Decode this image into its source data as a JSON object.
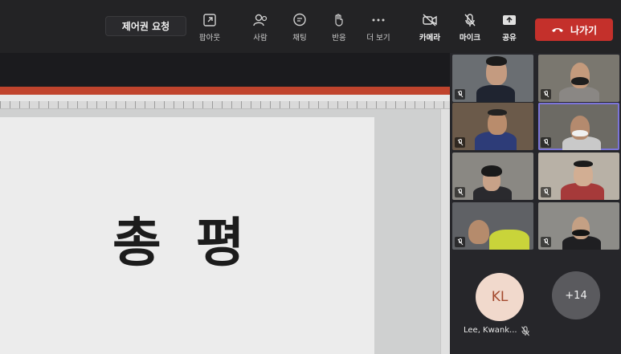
{
  "toolbar": {
    "request_control": "제어권 요청",
    "popout": "팝아웃",
    "people": "사람",
    "chat": "채팅",
    "reactions": "반응",
    "more": "더 보기",
    "camera": "카메라",
    "mic": "마이크",
    "share": "공유",
    "leave": "나가기"
  },
  "presentation": {
    "slide_title": "총 평"
  },
  "participants": {
    "tiles": [
      {
        "muted": true
      },
      {
        "muted": true
      },
      {
        "muted": true
      },
      {
        "muted": true
      },
      {
        "muted": true
      },
      {
        "muted": true
      },
      {
        "muted": true
      },
      {
        "muted": true
      }
    ],
    "avatar_initials": "KL",
    "avatar_name": "Lee, Kwank...",
    "overflow_count": "+14"
  },
  "colors": {
    "leave": "#c4302b",
    "active_speaker": "#7b74d9",
    "ppt_titlebar": "#c0442d"
  }
}
